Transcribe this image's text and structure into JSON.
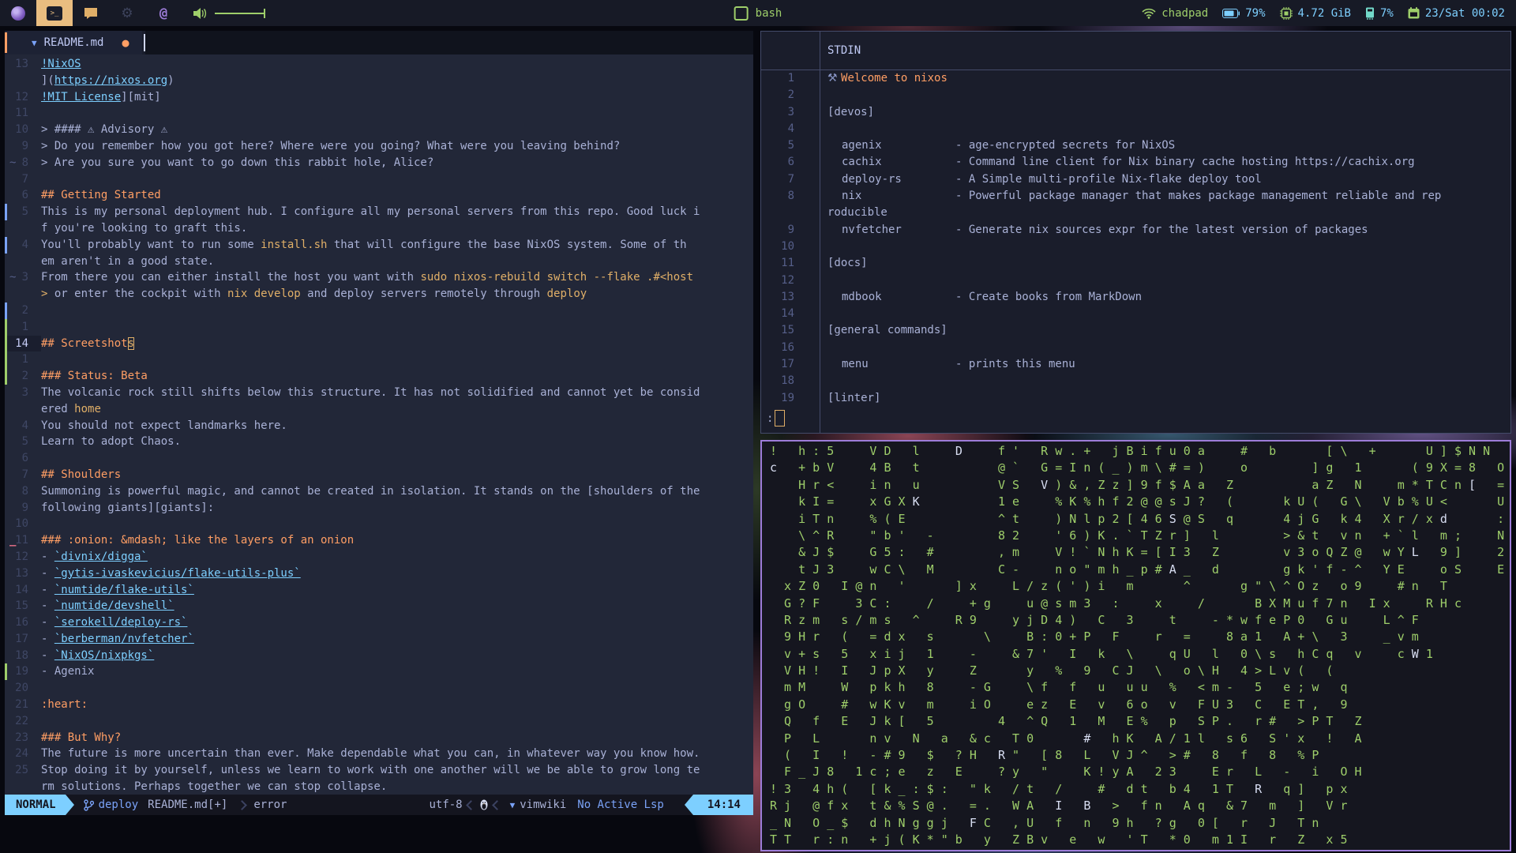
{
  "topbar": {
    "window_title": "bash",
    "launchers": {
      "firefox": "firefox",
      "terminal": "terminal",
      "chat": "chat",
      "settings": "settings",
      "mail": "at"
    },
    "status": {
      "network": "chadpad",
      "battery": "79%",
      "memory": "4.72 GiB",
      "cpu": "7%",
      "clock": "23/Sat 00:02"
    }
  },
  "editor": {
    "tab": {
      "file": "README.md",
      "modified_dot": "●",
      "arrow": "▼"
    },
    "statusline": {
      "mode": "NORMAL",
      "branch": "deploy",
      "file": "README.md[+]",
      "diagnostic": "error",
      "encoding": "utf-8",
      "filetype": "vimwiki",
      "lsp": "No Active Lsp",
      "time": "14:14",
      "filetype_icon": "▼"
    },
    "lines": [
      {
        "n": "13",
        "s": [
          [
            "!NixOS",
            "l"
          ]
        ]
      },
      {
        "n": "",
        "s": [
          [
            "](",
            ""
          ],
          [
            "https://nixos.org",
            "l"
          ],
          [
            ")",
            ""
          ]
        ]
      },
      {
        "n": "12",
        "s": [
          [
            "!MIT License",
            "l"
          ],
          [
            "][mit]",
            ""
          ]
        ]
      },
      {
        "n": "11",
        "s": []
      },
      {
        "n": "10",
        "s": [
          [
            "> #### ⚠ Advisory ⚠",
            ""
          ]
        ]
      },
      {
        "n": "9",
        "s": [
          [
            "> Do you remember how you got here? Where were you going? What were you leaving behind?",
            ""
          ]
        ]
      },
      {
        "n": "8",
        "sign": "~",
        "s": [
          [
            "> Are you sure you want to go down this rabbit hole, Alice?",
            ""
          ]
        ]
      },
      {
        "n": "7",
        "s": []
      },
      {
        "n": "6",
        "s": [
          [
            "## Getting Started",
            "h"
          ]
        ]
      },
      {
        "n": "5",
        "bar": "b",
        "s": [
          [
            "This is my personal deployment hub. I configure all my personal servers from this repo. Good luck i",
            ""
          ]
        ]
      },
      {
        "n": "",
        "s": [
          [
            "f you're looking to graft this.",
            ""
          ]
        ]
      },
      {
        "n": "4",
        "bar": "b",
        "s": [
          [
            "You'll probably want to run some ",
            ""
          ],
          [
            "install.sh",
            "c"
          ],
          [
            " that will configure the base NixOS system. Some of th",
            ""
          ]
        ]
      },
      {
        "n": "",
        "s": [
          [
            "em aren't in a good state.",
            ""
          ]
        ]
      },
      {
        "n": "3",
        "sign": "~",
        "s": [
          [
            "From there you can either install the host you want with ",
            ""
          ],
          [
            "sudo nixos-rebuild switch --flake .#<host",
            "c"
          ]
        ]
      },
      {
        "n": "",
        "s": [
          [
            "> ",
            "c"
          ],
          [
            "or enter the cockpit with ",
            ""
          ],
          [
            "nix develop",
            "c"
          ],
          [
            " and deploy servers remotely through ",
            ""
          ],
          [
            "deploy",
            "c"
          ]
        ]
      },
      {
        "n": "2",
        "bar": "b",
        "s": []
      },
      {
        "n": "1",
        "bar": "g",
        "s": []
      },
      {
        "n": "14",
        "cur": true,
        "bar": "g",
        "s": [
          [
            "## Screetshot",
            "h"
          ],
          [
            "s",
            "x"
          ]
        ]
      },
      {
        "n": "1",
        "bar": "g",
        "s": []
      },
      {
        "n": "2",
        "bar": "g",
        "s": [
          [
            "### Status: Beta",
            "h"
          ]
        ]
      },
      {
        "n": "3",
        "s": [
          [
            "The volcanic rock still shifts below this structure. It has not solidified and cannot yet be consid",
            ""
          ]
        ]
      },
      {
        "n": "",
        "s": [
          [
            "ered ",
            ""
          ],
          [
            "home",
            "c"
          ]
        ]
      },
      {
        "n": "4",
        "s": [
          [
            "You should not expect landmarks here.",
            ""
          ]
        ]
      },
      {
        "n": "5",
        "s": [
          [
            "Learn to adopt Chaos.",
            ""
          ]
        ]
      },
      {
        "n": "6",
        "s": []
      },
      {
        "n": "7",
        "s": [
          [
            "## Shoulders",
            "h"
          ]
        ]
      },
      {
        "n": "8",
        "s": [
          [
            "Summoning is powerful magic, and cannot be created in isolation. It stands on the [shoulders of the",
            ""
          ]
        ]
      },
      {
        "n": "9",
        "s": [
          [
            "following giants][giants]:",
            ""
          ]
        ]
      },
      {
        "n": "10",
        "s": []
      },
      {
        "n": "11",
        "sign": "_",
        "s": [
          [
            "### :onion: &mdash; like the layers of an onion",
            "h"
          ]
        ]
      },
      {
        "n": "12",
        "s": [
          [
            "- ",
            ""
          ],
          [
            "`divnix/digga`",
            "l"
          ]
        ]
      },
      {
        "n": "13",
        "s": [
          [
            "- ",
            ""
          ],
          [
            "`gytis-ivaskevicius/flake-utils-plus`",
            "l"
          ]
        ]
      },
      {
        "n": "14",
        "s": [
          [
            "- ",
            ""
          ],
          [
            "`numtide/flake-utils`",
            "l"
          ]
        ]
      },
      {
        "n": "15",
        "s": [
          [
            "- ",
            ""
          ],
          [
            "`numtide/devshell`",
            "l"
          ]
        ]
      },
      {
        "n": "16",
        "s": [
          [
            "- ",
            ""
          ],
          [
            "`serokell/deploy-rs`",
            "l"
          ]
        ]
      },
      {
        "n": "17",
        "s": [
          [
            "- ",
            ""
          ],
          [
            "`berberman/nvfetcher`",
            "l"
          ]
        ]
      },
      {
        "n": "18",
        "s": [
          [
            "- ",
            ""
          ],
          [
            "`NixOS/nixpkgs`",
            "l"
          ]
        ]
      },
      {
        "n": "19",
        "bar": "g",
        "s": [
          [
            "- Agenix",
            ""
          ]
        ]
      },
      {
        "n": "20",
        "s": []
      },
      {
        "n": "21",
        "s": [
          [
            ":heart:",
            "h"
          ]
        ]
      },
      {
        "n": "22",
        "s": []
      },
      {
        "n": "23",
        "s": [
          [
            "### But Why?",
            "h"
          ]
        ]
      },
      {
        "n": "24",
        "s": [
          [
            "The future is more uncertain than ever. Make dependable what you can, in whatever way you know how.",
            ""
          ]
        ]
      },
      {
        "n": "25",
        "s": [
          [
            "Stop doing it by yourself, unless we learn to work with one another will we be able to grow long te",
            ""
          ]
        ]
      },
      {
        "n": "",
        "s": [
          [
            "rm solutions. Perhaps together we can stop collapse.",
            ""
          ]
        ]
      }
    ]
  },
  "pager": {
    "title": "STDIN",
    "prompt": ":",
    "lines": [
      {
        "n": "1",
        "s": [
          [
            "⚒ ",
            "i"
          ],
          [
            "Welcome to nixos",
            "o"
          ]
        ]
      },
      {
        "n": "2"
      },
      {
        "n": "3",
        "plain": "[devos]"
      },
      {
        "n": "4"
      },
      {
        "n": "5",
        "name": "agenix",
        "desc": "- age-encrypted secrets for NixOS"
      },
      {
        "n": "6",
        "name": "cachix",
        "desc": "- Command line client for Nix binary cache hosting https://cachix.org"
      },
      {
        "n": "7",
        "name": "deploy-rs",
        "desc": "- A Simple multi-profile Nix-flake deploy tool"
      },
      {
        "n": "8",
        "name": "nix",
        "desc": "- Powerful package manager that makes package management reliable and rep"
      },
      {
        "n": "",
        "plain": "roducible"
      },
      {
        "n": "9",
        "name": "nvfetcher",
        "desc": "- Generate nix sources expr for the latest version of packages"
      },
      {
        "n": "10"
      },
      {
        "n": "11",
        "plain": "[docs]"
      },
      {
        "n": "12"
      },
      {
        "n": "13",
        "name": "mdbook",
        "desc": "- Create books from MarkDown"
      },
      {
        "n": "14"
      },
      {
        "n": "15",
        "plain": "[general commands]"
      },
      {
        "n": "16"
      },
      {
        "n": "17",
        "name": "menu",
        "desc": "- prints this menu"
      },
      {
        "n": "18"
      },
      {
        "n": "19",
        "plain": "[linter]"
      }
    ]
  },
  "matrix": {
    "rows": [
      [
        [
          "!   h : 5     V D   l     ",
          ""
        ],
        [
          "D",
          "w"
        ],
        [
          "     f '   R w . +   j B i f u 0 a     #   b       [ \\   +       U ] $ N N",
          ""
        ]
      ],
      [
        [
          "c",
          "w"
        ],
        [
          "   + b V     4 B   t           @ `   G = I n ( _ ) m \\ # = )     o         ] g   1       ( 9 X = 8   O",
          ""
        ]
      ],
      [
        [
          "    H r <     i n   u           V S   ",
          ""
        ],
        [
          "V",
          "w"
        ],
        [
          " ) & , Z z ] 9 f $ A a   Z           a Z   N     m * T C n ",
          ""
        ],
        [
          "[",
          "w"
        ],
        [
          "   =",
          ""
        ]
      ],
      [
        [
          "    k I =     x G X ",
          ""
        ],
        [
          "K",
          "w"
        ],
        [
          "           1 e     % K % h f 2 @ @ s J ?   (       k U (   G \\   V b % U <       U",
          ""
        ]
      ],
      [
        [
          "    i T n     % ( E             ^ t     ) N l p 2 [ 4 6 ",
          ""
        ],
        [
          "S",
          "w"
        ],
        [
          " @ S   q       4 j G   k 4   X r / x ",
          ""
        ],
        [
          "d",
          "w"
        ],
        [
          "       :",
          ""
        ]
      ],
      [
        [
          "    \\ ^ R     \" b '   -         8 2     ' 6 ) K . ` T Z r ]   l         > & t   v n   + ` l   m ;     N",
          ""
        ]
      ],
      [
        [
          "    & J $     G 5 :   #         , m     V ! ` N h K = [ I 3   Z         v 3 o Q Z @   w Y ",
          ""
        ],
        [
          "L",
          "w"
        ],
        [
          "   9 ]     2",
          ""
        ]
      ],
      [
        [
          "    t J 3     w C \\   M         C -     n o \" m h _ p # ",
          ""
        ],
        [
          "A",
          "w"
        ],
        [
          " _   d         g k ' f - ^   Y E     o S     E",
          ""
        ]
      ],
      [
        [
          "  x Z 0   I @ n   '       ] x     L / z ( ' ) i   m       ^       g \" \\ ^ O z   o 9     # n   T",
          ""
        ]
      ],
      [
        [
          "  G ? F     3 C :     /     + g     u @ s m 3   :     x     /       B X M u f 7 n   I x     R H c",
          ""
        ]
      ],
      [
        [
          "  R z m   s / m s   ^     R 9     y j D 4 )   C   3     t     - * w f e P 0   G u     L ^ F",
          ""
        ]
      ],
      [
        [
          "  9 H r   (   = d x   s       \\     B : 0 + P   F     r   =     8 a 1   A + \\   3     _ v m",
          ""
        ]
      ],
      [
        [
          "  v + s   5   x i j   1     -     & 7 '   I   k   \\     q U   l   0 \\ s   h C q   v     c ",
          ""
        ],
        [
          "W",
          "w"
        ],
        [
          " 1",
          ""
        ]
      ],
      [
        [
          "  V H !   I   J p X   y     Z       y   %   9   C J   \\   o \\ H   4 > L v (   (",
          ""
        ]
      ],
      [
        [
          "  m M     W   p k h   8     - G     \\ f   f   u   u u   %   < m -   5   e ; w   q",
          ""
        ]
      ],
      [
        [
          "  g O     #   w K v   m     i O     e z   E   v   6 o   v   F U 3   C   E T ,   9",
          ""
        ]
      ],
      [
        [
          "  Q   f   E   J k [   5         4   ^ Q   1   M   E %   p   S P .   r #   > P T   Z",
          ""
        ]
      ],
      [
        [
          "  P   L       n v   N   a   & c   T 0       ",
          ""
        ],
        [
          "#",
          "w"
        ],
        [
          "   h K   A / 1 l   s 6   S ' x   !   A",
          ""
        ]
      ],
      [
        [
          "  (   I   !   - # 9   $   ? H   ",
          ""
        ],
        [
          "R",
          "w"
        ],
        [
          " \"   [ 8   L   V J ^   > #   8   f   8   % P",
          ""
        ]
      ],
      [
        [
          "  F _ J 8   1 c ; e   z   E     ? y   \"     K ! y A   2 3     E r   L   -   i   O H",
          ""
        ]
      ],
      [
        [
          "! 3   4 h (   [ k _ : $ :   \" k   / t   /     #   d t   b 4   1 T   ",
          ""
        ],
        [
          "R",
          "w"
        ],
        [
          "   q ]   p x",
          ""
        ]
      ],
      [
        [
          "R j   @ f x   t & % S @ .   = .   W A   ",
          ""
        ],
        [
          "I",
          "w"
        ],
        [
          "   ",
          ""
        ],
        [
          "B",
          "w"
        ],
        [
          "   >   f n   A q   & 7   m   ]   V r",
          ""
        ]
      ],
      [
        [
          "_ N   O _ $   d h N g g j   ",
          ""
        ],
        [
          "F",
          "w"
        ],
        [
          " C   , U   f   n   9 h   ? g   0 [   r   J   T n",
          ""
        ]
      ],
      [
        [
          "T T   r : n   + j ( K * \" b   y   Z B v   e   w   ' T   * 0   m 1 I   r   Z   x 5",
          ""
        ]
      ]
    ]
  }
}
